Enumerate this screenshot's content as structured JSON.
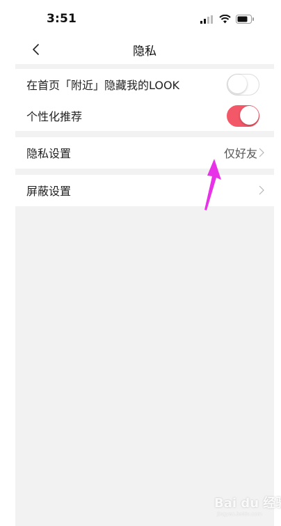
{
  "status_bar": {
    "time": "3:51",
    "icons": [
      "signal-icon",
      "wifi-icon",
      "battery-icon"
    ]
  },
  "nav": {
    "title": "隐私",
    "back_icon": "chevron-left-icon"
  },
  "toggles": [
    {
      "label": "在首页「附近」隐藏我的LOOK",
      "state": "off"
    },
    {
      "label": "个性化推荐",
      "state": "on"
    }
  ],
  "privacy_setting": {
    "label": "隐私设置",
    "value": "仅好友"
  },
  "block_setting": {
    "label": "屏蔽设置"
  },
  "watermark": {
    "brand": "Bai du 经验",
    "sub": "jingyan.baidu.com"
  },
  "colors": {
    "accent": "#f25868",
    "arrow": "#e832e8",
    "background": "#f2f2f2"
  }
}
